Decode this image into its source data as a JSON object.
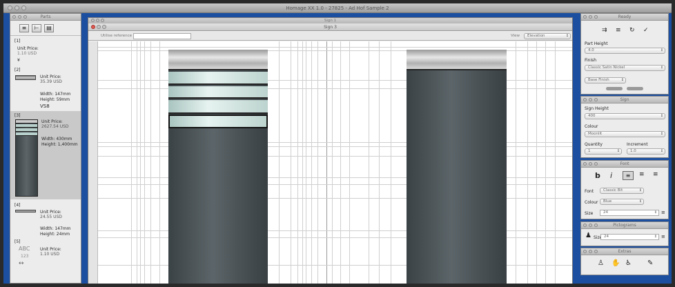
{
  "window": {
    "title": "Homage XX 1.0 - 27825 - Ad Hof Sample 2"
  },
  "parts_panel": {
    "title": "Parts",
    "items": [
      {
        "index": "[1]",
        "price_label": "Unit Price:",
        "price": "1.10 USD",
        "extra": "¥"
      },
      {
        "index": "[2]",
        "price_label": "Unit Price:",
        "price": "35.39 USD",
        "width": "Width: 147mm",
        "height": "Height: 59mm",
        "sku": "VS8"
      },
      {
        "index": "[3]",
        "price_label": "Unit Price:",
        "price": "2627.54 USD",
        "width": "Width: 430mm",
        "height": "Height: 1,400mm"
      },
      {
        "index": "[4]",
        "price_label": "Unit Price:",
        "price": "24.55 USD",
        "width": "Width: 147mm",
        "height": "Height: 24mm"
      },
      {
        "index": "[5]",
        "price_label": "Unit Price:",
        "price": "1.10 USD",
        "abc": "ABC",
        "num": "123"
      }
    ]
  },
  "document": {
    "outer_title": "Sign 1",
    "inner_title": "Sign 3",
    "toolbar_label": "Utilise reference",
    "view_label": "View",
    "view_value": "Elevation"
  },
  "ready_panel": {
    "title": "Ready",
    "label_a": "Part Height",
    "select_a": "4.0",
    "label_b": "Finish",
    "select_b": "Classic Satin Nickel",
    "select_c": "Base Finish"
  },
  "sign_panel": {
    "title": "Sign",
    "label_a": "Sign Height",
    "select_a": "400",
    "label_b": "Colour",
    "select_b": "Moonlit",
    "label_qty": "Quantity",
    "label_spacing": "Increment",
    "qty": "1",
    "spacing": "1.0"
  },
  "font_panel": {
    "title": "Font",
    "bold": "b",
    "italic": "i",
    "font_label": "Font",
    "font_value": "Classic Bit",
    "colour_label": "Colour",
    "colour_value": "Blue",
    "size_label": "Size",
    "size_value": "24"
  },
  "pictogram_panel": {
    "title": "Pictograms",
    "size_label": "Size",
    "size_value": "24"
  },
  "extras_panel": {
    "title": "Extras"
  }
}
